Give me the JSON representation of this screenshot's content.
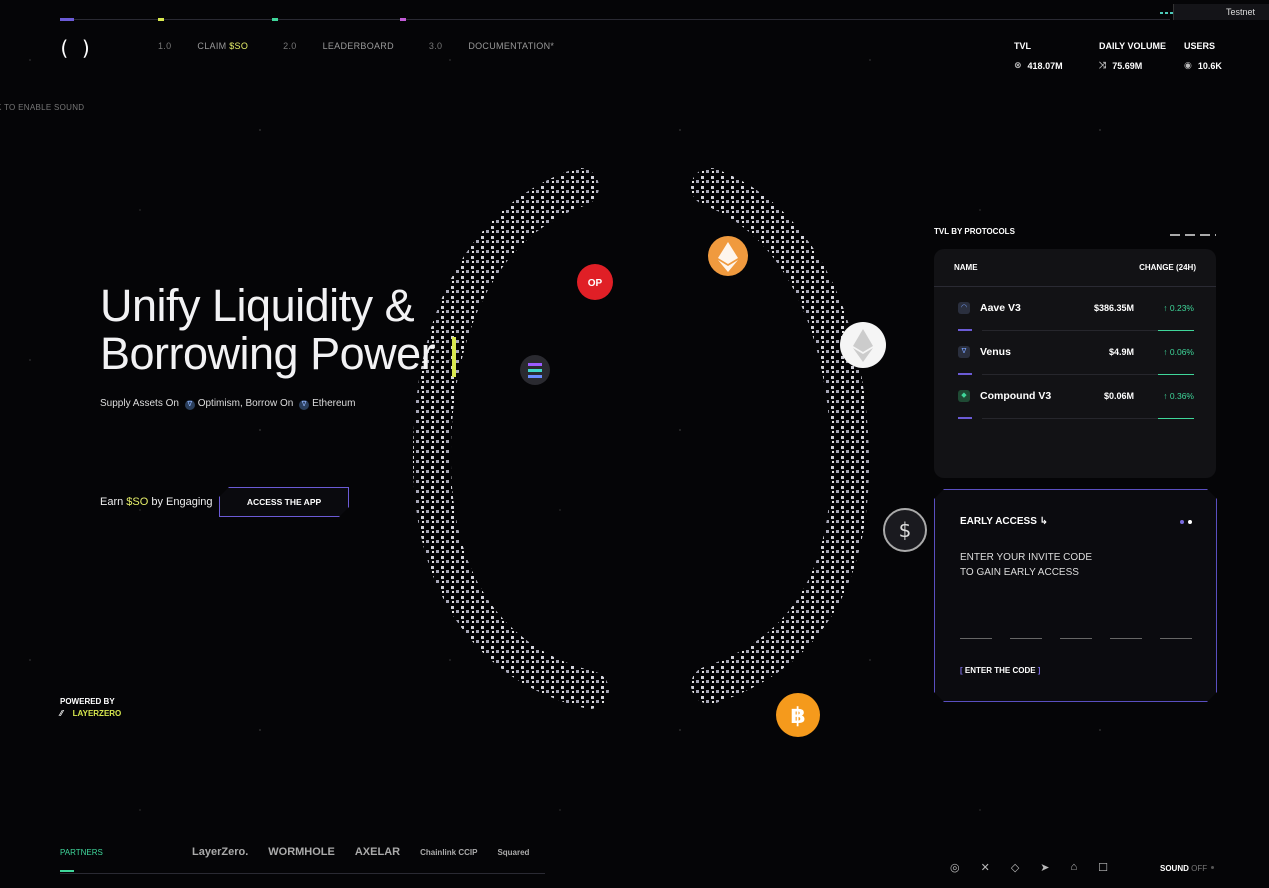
{
  "env": "Testnet",
  "nav": [
    {
      "num": "1.0",
      "label": "CLAIM ",
      "highlight": "$SO"
    },
    {
      "num": "2.0",
      "label": "LEADERBOARD",
      "highlight": ""
    },
    {
      "num": "3.0",
      "label": "DOCUMENTATION",
      "highlight": ""
    }
  ],
  "stats": [
    {
      "label": "TVL",
      "value": "418.07M",
      "icon": "layers-icon"
    },
    {
      "label": "DAILY VOLUME",
      "value": "75.69M",
      "icon": "swap-icon"
    },
    {
      "label": "USERS",
      "value": "10.6K",
      "icon": "eye-icon"
    }
  ],
  "sound_hint": "K TO ENABLE SOUND",
  "hero": {
    "title_line1": "Unify Liquidity &",
    "title_line2": "Borrowing Power",
    "sub_prefix": "Supply Assets On",
    "sub_chain1": "Optimism, Borrow On",
    "sub_chain2": "Ethereum",
    "earn_prefix": "Earn ",
    "earn_token": "$SO",
    "earn_suffix": " by Engaging",
    "cta": "ACCESS THE APP"
  },
  "powered": {
    "label": "POWERED BY",
    "name": "LAYERZERO"
  },
  "tvl_protocols": {
    "title": "TVL BY PROTOCOLS",
    "col_name": "NAME",
    "col_change": "CHANGE (24H)",
    "rows": [
      {
        "name": "Aave V3",
        "amount": "$386.35M",
        "change": "↑ 0.23%"
      },
      {
        "name": "Venus",
        "amount": "$4.9M",
        "change": "↑ 0.06%"
      },
      {
        "name": "Compound V3",
        "amount": "$0.06M",
        "change": "↑ 0.36%"
      }
    ]
  },
  "early_access": {
    "title": "EARLY ACCESS",
    "text_line1": "ENTER YOUR INVITE CODE",
    "text_line2": "TO GAIN EARLY ACCESS",
    "button": "ENTER THE CODE"
  },
  "footer": {
    "partners_label": "PARTNERS",
    "partners": [
      "LayerZero.",
      "WORMHOLE",
      "AXELAR",
      "Chainlink CCIP",
      "Squared"
    ],
    "sound_label": "SOUND",
    "sound_state": "OFF"
  },
  "colors": {
    "accent_yellow": "#d8e84f",
    "accent_purple": "#6b5bd6",
    "accent_green": "#3fd69a"
  }
}
